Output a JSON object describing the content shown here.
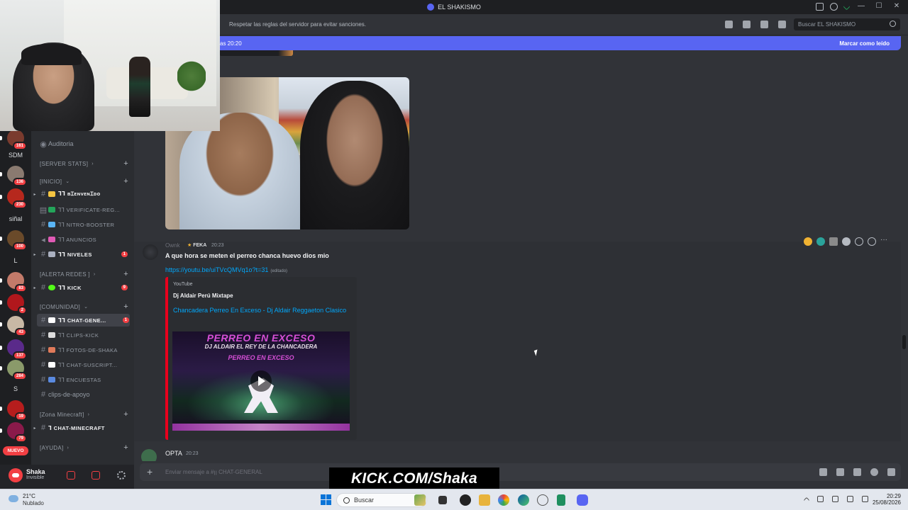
{
  "window": {
    "title": "EL SHAKISMO"
  },
  "header": {
    "topic": "Respetar las reglas del servidor para evitar sanciones.",
    "search_placeholder": "Buscar EL SHAKISMO"
  },
  "new_messages_bar": {
    "left": "as 20:20",
    "right": "Marcar como leído"
  },
  "rail": {
    "servers": [
      {
        "label": "",
        "badge": "161",
        "color": "#7a3b2e"
      },
      {
        "label": "SDM",
        "badge": "",
        "color": ""
      },
      {
        "label": "",
        "badge": "136",
        "color": "#8a7a70"
      },
      {
        "label": "",
        "badge": "230",
        "color": "#b6281d"
      },
      {
        "label": "siñal",
        "badge": "",
        "color": ""
      },
      {
        "label": "",
        "badge": "100",
        "color": "#6a4a2a"
      },
      {
        "label": "L",
        "badge": "",
        "color": ""
      },
      {
        "label": "",
        "badge": "83",
        "color": "#c27a6a"
      },
      {
        "label": "",
        "badge": "2",
        "color": "#b1171c"
      },
      {
        "label": "",
        "badge": "43",
        "color": "#c8b8a5"
      },
      {
        "label": "",
        "badge": "137",
        "color": "#5a2a8a"
      },
      {
        "label": "",
        "badge": "284",
        "color": "#8a9a6a"
      },
      {
        "label": "S",
        "badge": "",
        "color": ""
      },
      {
        "label": "",
        "badge": "19",
        "color": "#b61d1d"
      },
      {
        "label": "",
        "badge": "79",
        "color": "#8a1a4a"
      }
    ],
    "new_label": "NUEVO"
  },
  "sidebar": {
    "audit_label": "Auditoria",
    "categories": {
      "server_stats": "[SERVER STATS]",
      "inicio": "[INICIO]",
      "alerta_redes": "[ALERTA REDES ]",
      "comunidad": "[COMUNIDAD]",
      "zona_minecraft": "[Zona Minecraft]",
      "ayuda": "[AYUDA]"
    },
    "channels": [
      {
        "name": "ꞁꞁ ʙɪᴇɴᴠᴇɴɪᴅᴏ",
        "badge": "",
        "emoji": "#f5c542",
        "unread": true
      },
      {
        "name": "ꞁꞁ verificate-reg...",
        "badge": "",
        "emoji": "#23a55a",
        "unread": false
      },
      {
        "name": "ꞁꞁ nitro-booster",
        "badge": "",
        "emoji": "#5ab5f5",
        "unread": false
      },
      {
        "name": "ꞁꞁ anuncios",
        "badge": "",
        "emoji": "#e05ab5",
        "unread": false
      },
      {
        "name": "ꞁꞁ niveles",
        "badge": "1",
        "emoji": "#aab0c0",
        "unread": true
      },
      {
        "name": "ꞁꞁ kick",
        "badge": "9",
        "emoji": "#53fc18",
        "unread": true
      },
      {
        "name": "ꞁꞁ chat-gene...",
        "badge": "1",
        "emoji": "#ffffff",
        "unread": true
      },
      {
        "name": "ꞁꞁ clips-kick",
        "badge": "",
        "emoji": "#dddddd",
        "unread": false
      },
      {
        "name": "ꞁꞁ fotos-de-shaka",
        "badge": "",
        "emoji": "#e07a5a",
        "unread": false
      },
      {
        "name": "ꞁꞁ chat-suscript...",
        "badge": "",
        "emoji": "#ffffff",
        "unread": false
      },
      {
        "name": "ꞁꞁ encuestas",
        "badge": "",
        "emoji": "#5a8ae0",
        "unread": false
      },
      {
        "name": "clips-de-apoyo",
        "badge": "",
        "emoji": "",
        "unread": false
      },
      {
        "name": "ꞁ chat-minecraft",
        "badge": "",
        "emoji": "",
        "unread": true
      }
    ]
  },
  "user": {
    "name": "Shaka",
    "status": "Invisible"
  },
  "message": {
    "author": "Ownk",
    "tag": "FEKA",
    "time": "20:23",
    "text": "A que hora se meten el perreo chanca huevo dios mio",
    "link": "https://youtu.be/uiTVcQMVq1o?t=31",
    "edited": "(editado)",
    "embed": {
      "provider": "YouTube",
      "author": "Dj Aldair Perú Mixtape",
      "title": "Chancadera  Perreo En Exceso - Dj Aldair Reggaeton Clasico",
      "thumb_big": "PERREO EN EXCESO",
      "thumb_sub": "DJ ALDAIR EL REY DE LA CHANCADERA",
      "thumb_inner": "PERREO EN EXCESO"
    }
  },
  "next_message": {
    "author": "OPTA",
    "time": "20:23"
  },
  "composer": {
    "placeholder": "Enviar mensaje a #ꞁꞁ CHAT-GENERAL"
  },
  "overlay": {
    "kick_text": "KICK.COM/Shaka"
  },
  "taskbar": {
    "temperature": "21°C",
    "weather": "Nublado",
    "search_label": "Buscar",
    "time": "20:29",
    "date": "25/08/2026"
  }
}
